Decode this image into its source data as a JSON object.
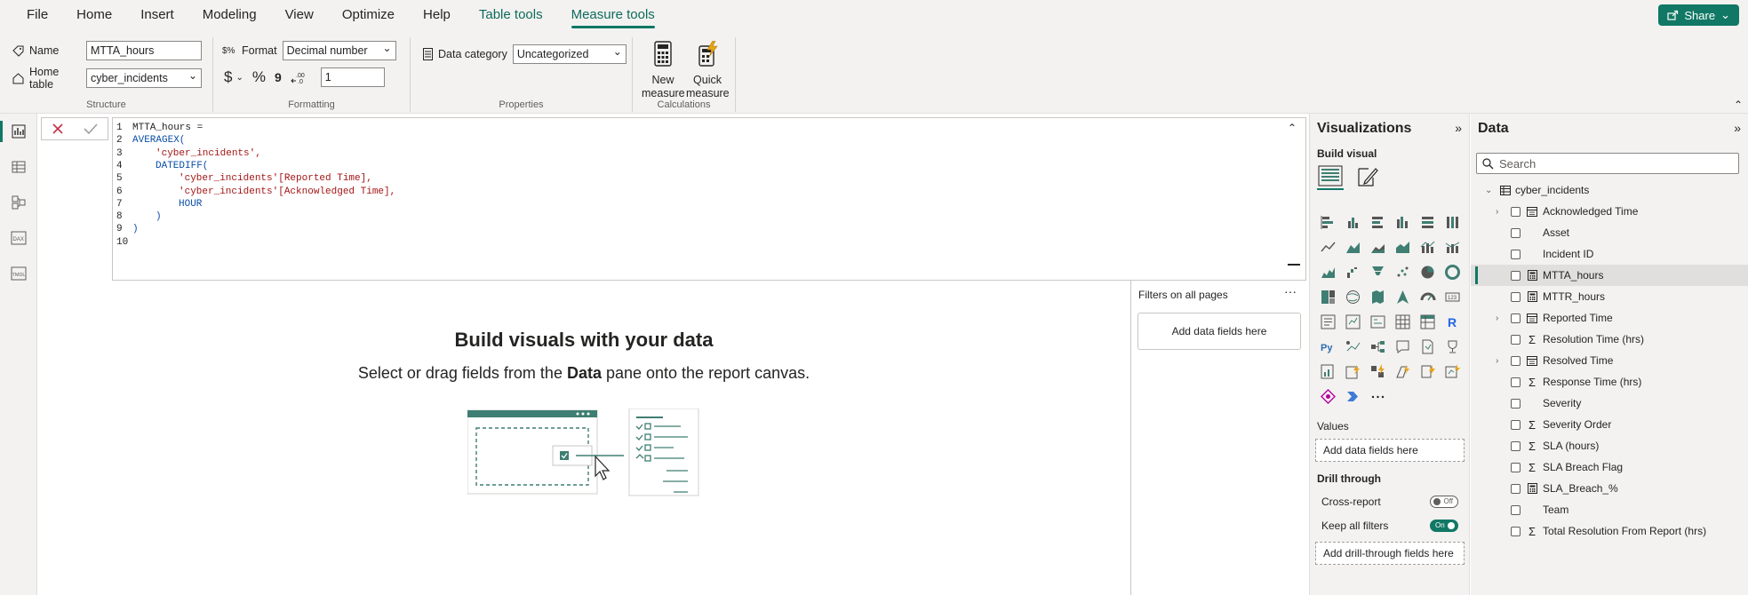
{
  "menu": {
    "tabs": [
      "File",
      "Home",
      "Insert",
      "Modeling",
      "View",
      "Optimize",
      "Help",
      "Table tools",
      "Measure tools"
    ],
    "share_label": "Share"
  },
  "ribbon": {
    "structure": {
      "name_label": "Name",
      "name_value": "MTTA_hours",
      "home_table_label": "Home table",
      "home_table_value": "cyber_incidents",
      "group_label": "Structure"
    },
    "formatting": {
      "format_label": "Format",
      "format_value": "Decimal number",
      "currency_symbol": "$",
      "percent_symbol": "%",
      "comma_symbol": "9",
      "decimals_value": "1",
      "group_label": "Formatting"
    },
    "properties": {
      "data_category_label": "Data category",
      "data_category_value": "Uncategorized",
      "group_label": "Properties"
    },
    "calculations": {
      "new_measure_line1": "New",
      "new_measure_line2": "measure",
      "quick_measure_line1": "Quick",
      "quick_measure_line2": "measure",
      "group_label": "Calculations"
    }
  },
  "formula": {
    "lines": [
      {
        "num": "1",
        "text": "MTTA_hours =",
        "kind": "plain",
        "indent": 0
      },
      {
        "num": "2",
        "text": "AVERAGEX(",
        "kind": "kw",
        "indent": 0
      },
      {
        "num": "3",
        "text": "'cyber_incidents',",
        "kind": "str",
        "indent": 1
      },
      {
        "num": "4",
        "text": "DATEDIFF(",
        "kind": "kw",
        "indent": 1
      },
      {
        "num": "5",
        "text": "'cyber_incidents'[Reported Time],",
        "kind": "str",
        "indent": 2
      },
      {
        "num": "6",
        "text": "'cyber_incidents'[Acknowledged Time],",
        "kind": "str",
        "indent": 2
      },
      {
        "num": "7",
        "text": "HOUR",
        "kind": "kw",
        "indent": 2
      },
      {
        "num": "8",
        "text": ")",
        "kind": "kw",
        "indent": 1
      },
      {
        "num": "9",
        "text": ")",
        "kind": "kw",
        "indent": 0
      },
      {
        "num": "10",
        "text": "",
        "kind": "plain",
        "indent": 0
      }
    ]
  },
  "canvas": {
    "empty_title": "Build visuals with your data",
    "empty_sub_pre": "Select or drag fields from the ",
    "empty_sub_bold": "Data",
    "empty_sub_post": " pane onto the report canvas."
  },
  "filters": {
    "title": "Filters on all pages",
    "more": "···",
    "add_label": "Add data fields here"
  },
  "visualizations": {
    "title": "Visualizations",
    "build_label": "Build visual",
    "values_label": "Values",
    "values_placeholder": "Add data fields here",
    "drill_label": "Drill through",
    "cross_report_label": "Cross-report",
    "cross_report_state": "Off",
    "keep_filters_label": "Keep all filters",
    "keep_filters_state": "On",
    "drill_placeholder": "Add drill-through fields here",
    "more_visuals": "···"
  },
  "data_pane": {
    "title": "Data",
    "search_placeholder": "Search",
    "table_name": "cyber_incidents",
    "fields": [
      {
        "name": "Acknowledged Time",
        "type": "date",
        "expand": true
      },
      {
        "name": "Asset",
        "type": "none",
        "expand": false
      },
      {
        "name": "Incident ID",
        "type": "none",
        "expand": false
      },
      {
        "name": "MTTA_hours",
        "type": "measure",
        "expand": false,
        "selected": true
      },
      {
        "name": "MTTR_hours",
        "type": "measure",
        "expand": false
      },
      {
        "name": "Reported Time",
        "type": "date",
        "expand": true
      },
      {
        "name": "Resolution Time (hrs)",
        "type": "sum",
        "expand": false
      },
      {
        "name": "Resolved Time",
        "type": "date",
        "expand": true
      },
      {
        "name": "Response Time (hrs)",
        "type": "sum",
        "expand": false
      },
      {
        "name": "Severity",
        "type": "none",
        "expand": false
      },
      {
        "name": "Severity Order",
        "type": "sum",
        "expand": false
      },
      {
        "name": "SLA (hours)",
        "type": "sum",
        "expand": false
      },
      {
        "name": "SLA Breach Flag",
        "type": "sum",
        "expand": false
      },
      {
        "name": "SLA_Breach_%",
        "type": "measure",
        "expand": false
      },
      {
        "name": "Team",
        "type": "none",
        "expand": false
      },
      {
        "name": "Total Resolution From Report (hrs)",
        "type": "sum",
        "expand": false
      }
    ]
  },
  "colors": {
    "accent": "#117865",
    "pane_bg": "#f3f2f1",
    "keyword": "#0b4fa8",
    "string": "#a31515"
  }
}
